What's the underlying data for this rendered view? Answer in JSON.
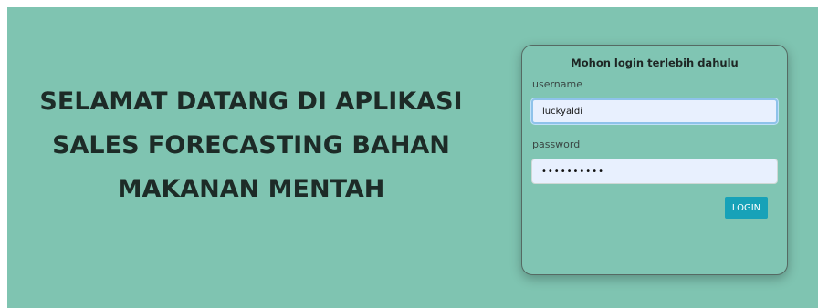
{
  "welcome": {
    "lines": [
      "SELAMAT DATANG DI APLIKASI",
      "SALES FORECASTING BAHAN",
      "MAKANAN MENTAH"
    ]
  },
  "login": {
    "title": "Mohon login terlebih dahulu",
    "username_label": "username",
    "username_value": "luckyaldi",
    "password_label": "password",
    "password_value": "••••••••••",
    "button_label": "LOGIN"
  },
  "colors": {
    "background": "#7fc4b1",
    "button": "#17a2b8",
    "input_autofill": "#e8f0fe"
  }
}
